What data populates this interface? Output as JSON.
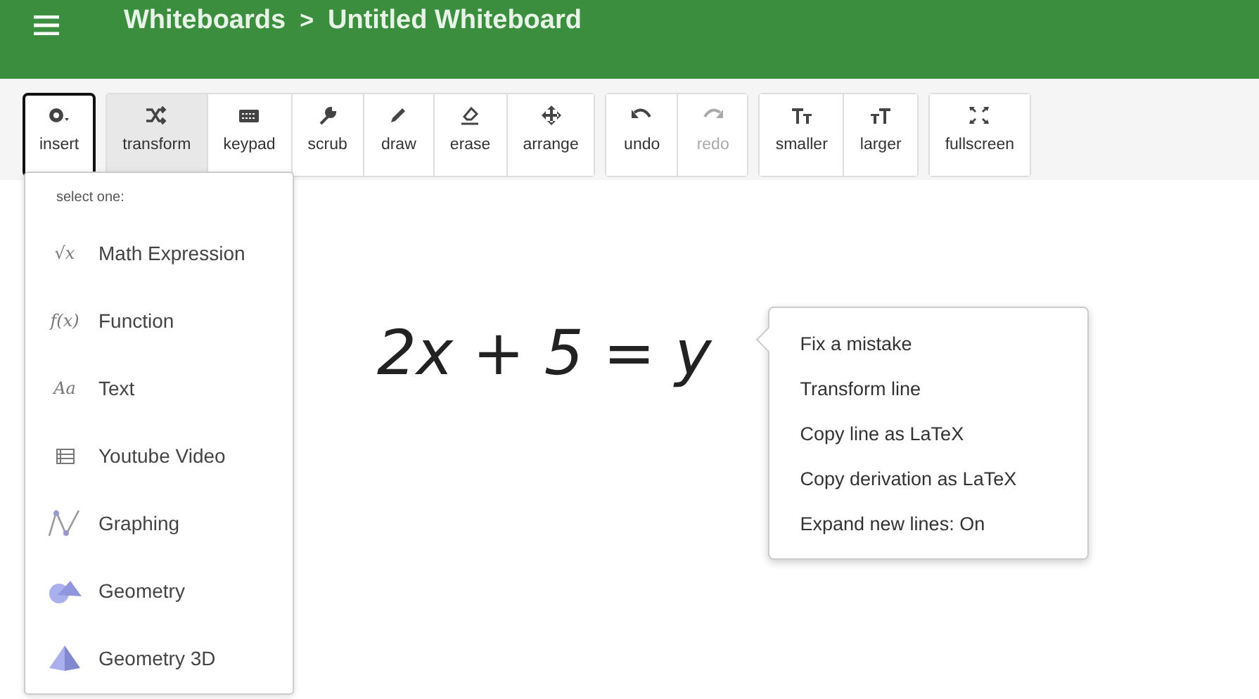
{
  "header": {
    "breadcrumb": [
      "Whiteboards",
      "Untitled Whiteboard"
    ],
    "separator": ">"
  },
  "toolbar": {
    "groups": [
      [
        {
          "label": "insert",
          "selected": false,
          "focused": true,
          "disabled": false
        }
      ],
      [
        {
          "label": "transform",
          "selected": true,
          "focused": false,
          "disabled": false
        },
        {
          "label": "keypad",
          "selected": false,
          "focused": false,
          "disabled": false
        },
        {
          "label": "scrub",
          "selected": false,
          "focused": false,
          "disabled": false
        },
        {
          "label": "draw",
          "selected": false,
          "focused": false,
          "disabled": false
        },
        {
          "label": "erase",
          "selected": false,
          "focused": false,
          "disabled": false
        },
        {
          "label": "arrange",
          "selected": false,
          "focused": false,
          "disabled": false
        }
      ],
      [
        {
          "label": "undo",
          "selected": false,
          "focused": false,
          "disabled": false
        },
        {
          "label": "redo",
          "selected": false,
          "focused": false,
          "disabled": true
        }
      ],
      [
        {
          "label": "smaller",
          "selected": false,
          "focused": false,
          "disabled": false
        },
        {
          "label": "larger",
          "selected": false,
          "focused": false,
          "disabled": false
        }
      ],
      [
        {
          "label": "fullscreen",
          "selected": false,
          "focused": false,
          "disabled": false
        }
      ]
    ]
  },
  "insert_menu": {
    "heading": "select one:",
    "items": [
      {
        "kind": "glyph",
        "glyph": "√x",
        "label": "Math Expression"
      },
      {
        "kind": "glyph",
        "glyph": "f(x)",
        "label": "Function"
      },
      {
        "kind": "glyph",
        "glyph": "Aa",
        "label": "Text"
      },
      {
        "kind": "video",
        "label": "Youtube Video"
      },
      {
        "kind": "graph",
        "label": "Graphing"
      },
      {
        "kind": "geometry",
        "label": "Geometry"
      },
      {
        "kind": "pyramid",
        "label": "Geometry 3D"
      }
    ]
  },
  "canvas": {
    "equation": "2x + 5 = y"
  },
  "context_menu": {
    "items": [
      "Fix a mistake",
      "Transform line",
      "Copy line as LaTeX",
      "Copy derivation as LaTeX",
      "Expand new lines: On"
    ]
  }
}
